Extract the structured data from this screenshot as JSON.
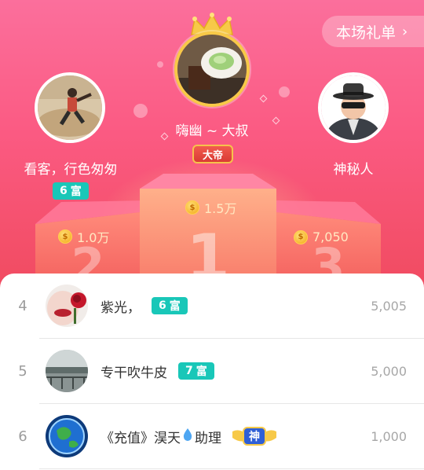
{
  "header": {
    "gift_list_label": "本场礼单",
    "chevron_icon": "chevron-right-icon"
  },
  "podium": {
    "first": {
      "rank": "1",
      "name": "嗨幽 ~ 大叔",
      "title_badge": "大帝",
      "amount": "1.5万",
      "icon": "crown-icon"
    },
    "second": {
      "rank": "2",
      "name": "看客，行色匆匆",
      "wealth_level": "6",
      "wealth_label": "富",
      "amount": "1.0万"
    },
    "third": {
      "rank": "3",
      "name": "神秘人",
      "amount": "7,050"
    }
  },
  "list": [
    {
      "rank": "4",
      "name": "紫光，",
      "badge_level": "6",
      "badge_label": "富",
      "amount": "5,005"
    },
    {
      "rank": "5",
      "name": "专干吹牛皮",
      "badge_level": "7",
      "badge_label": "富",
      "amount": "5,000"
    },
    {
      "rank": "6",
      "name": "《充值》淏天",
      "name_suffix": "助理",
      "badge_label": "神",
      "amount": "1,000"
    }
  ],
  "colors": {
    "hero_top": "#fb6f9c",
    "hero_bottom": "#f04a5e",
    "wealth_badge": "#19c7b8",
    "gold": "#f7c948"
  }
}
